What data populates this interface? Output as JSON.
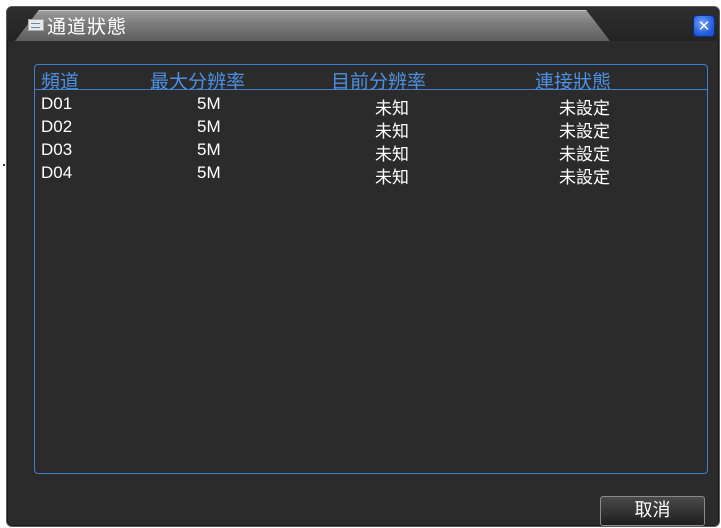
{
  "window": {
    "title": "通道狀態",
    "close_symbol": "✕"
  },
  "table": {
    "headers": [
      "頻道",
      "最大分辨率",
      "目前分辨率",
      "連接狀態"
    ],
    "rows": [
      {
        "channel": "D01",
        "max_res": "5M",
        "cur_res": "未知",
        "status": "未設定"
      },
      {
        "channel": "D02",
        "max_res": "5M",
        "cur_res": "未知",
        "status": "未設定"
      },
      {
        "channel": "D03",
        "max_res": "5M",
        "cur_res": "未知",
        "status": "未設定"
      },
      {
        "channel": "D04",
        "max_res": "5M",
        "cur_res": "未知",
        "status": "未設定"
      }
    ]
  },
  "buttons": {
    "cancel_label": "取消"
  },
  "colors": {
    "accent": "#3d7fd0",
    "background": "#2b2b2b",
    "text": "#ffffff"
  },
  "icons": {
    "title_icon": "window-list-icon",
    "close": "close-icon"
  }
}
